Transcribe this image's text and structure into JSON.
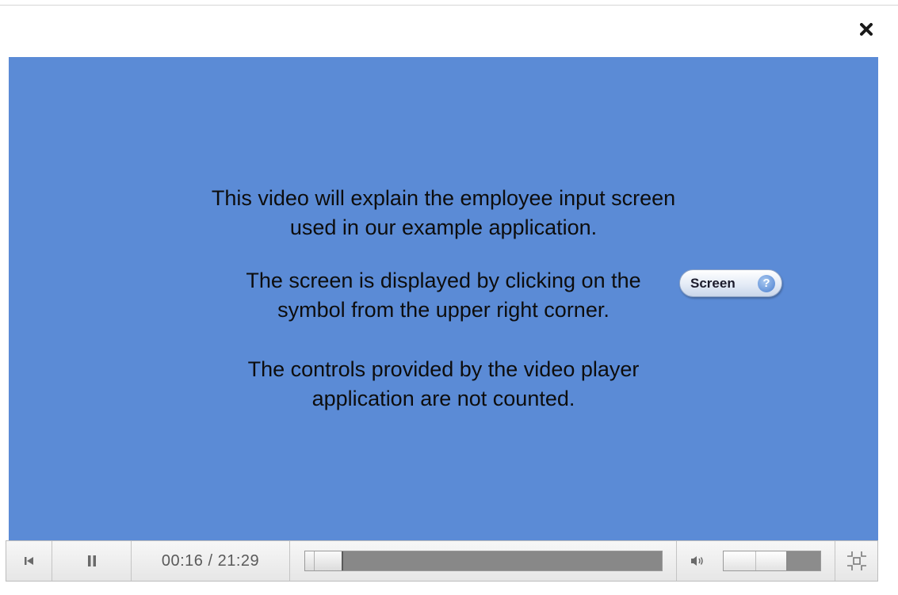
{
  "dialog": {
    "close_icon": "close-icon"
  },
  "video": {
    "background_color": "#5b8bd6",
    "text_1_line_1": "This video will explain the employee input screen",
    "text_1_line_2": "used in our example application.",
    "text_2_line_1": "The screen is displayed by clicking on the",
    "text_2_line_2": "symbol from the upper right corner.",
    "text_3_line_1": "The controls provided by the video player",
    "text_3_line_2": "application are not counted.",
    "screen_button_label": "Screen",
    "screen_button_help": "?"
  },
  "player": {
    "restart_icon": "skip-back-icon",
    "pause_icon": "pause-icon",
    "time_display": "00:16 / 21:29",
    "progress_fraction": 0.01,
    "volume_icon": "volume-icon",
    "volume_fraction": 0.65,
    "fullscreen_icon": "exit-fullscreen-icon"
  }
}
